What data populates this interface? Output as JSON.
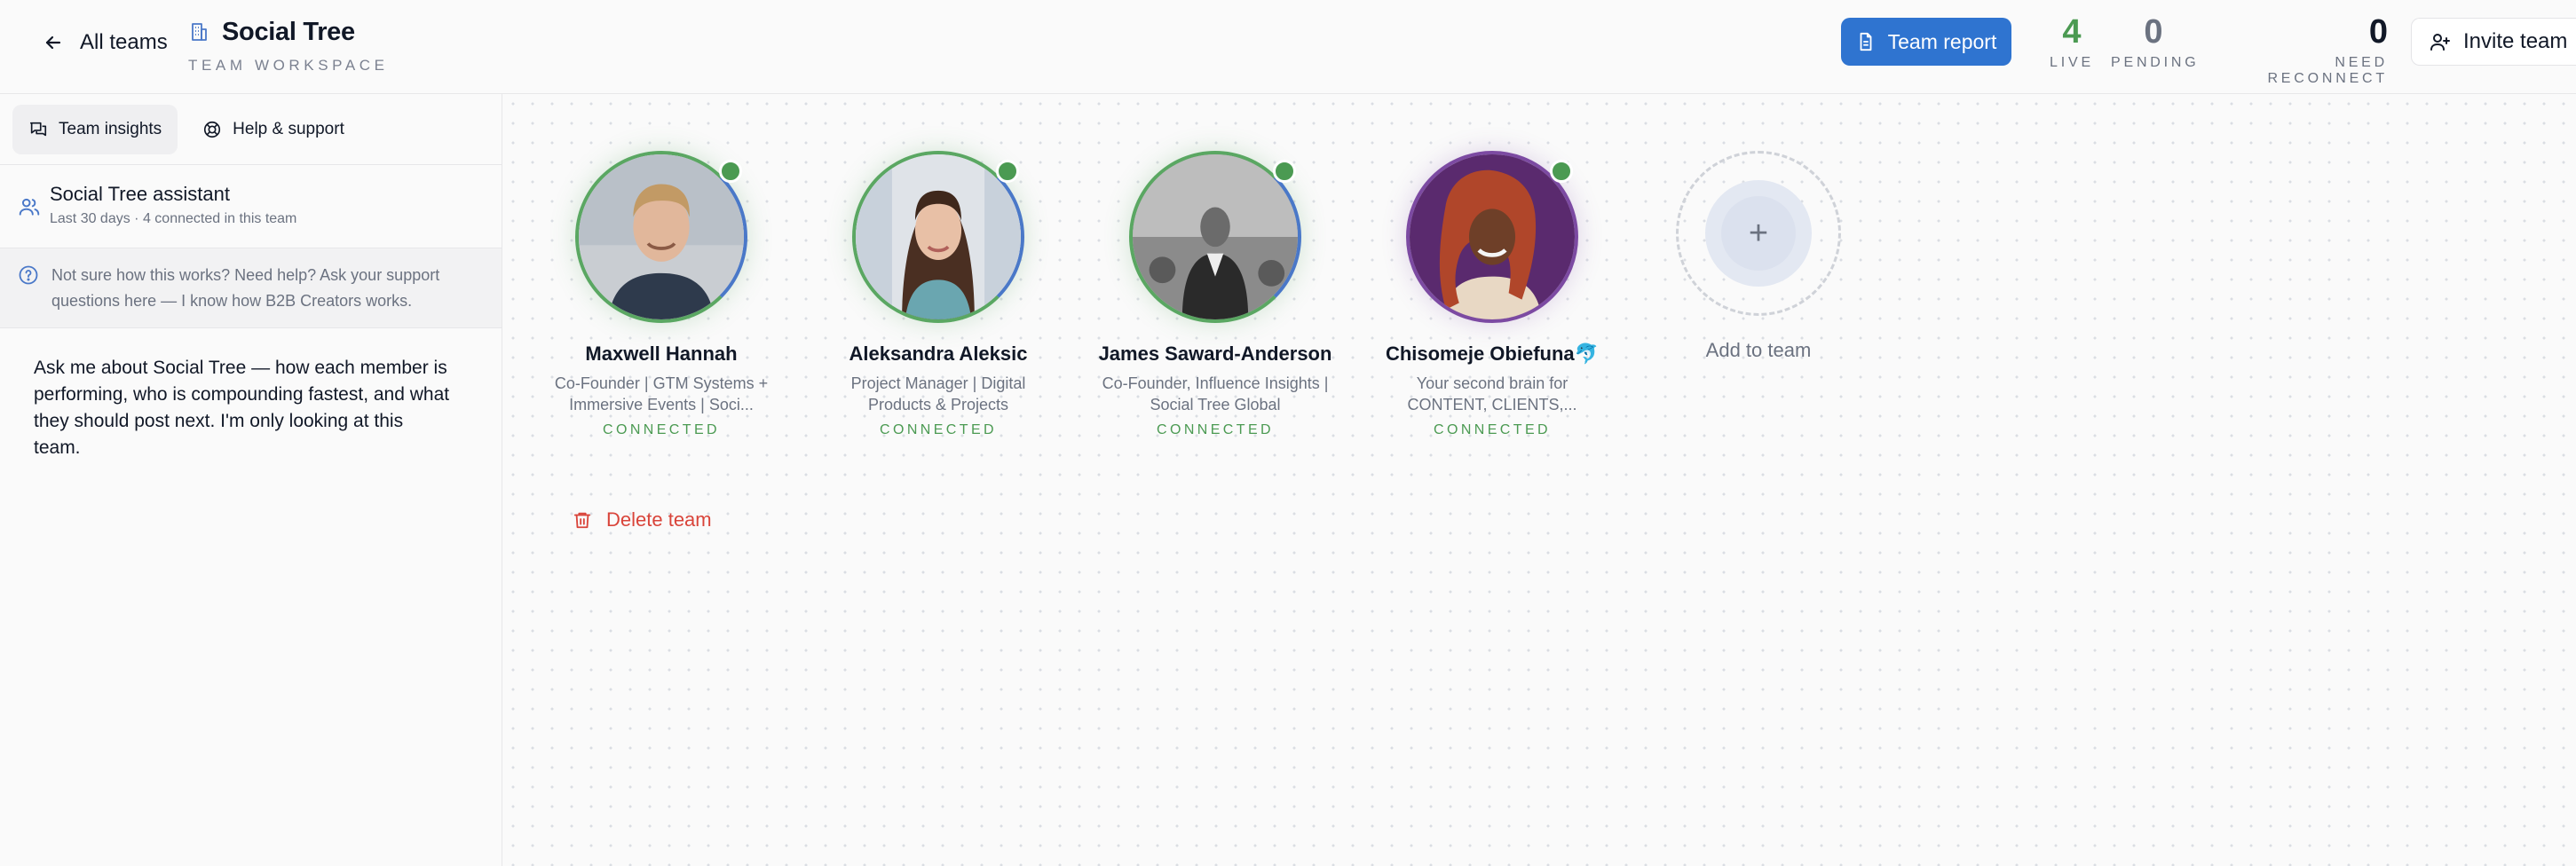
{
  "header": {
    "back_label": "All teams",
    "team_name": "Social Tree",
    "team_subtitle": "TEAM WORKSPACE",
    "report_label": "Team report",
    "invite_label": "Invite team",
    "stats": [
      {
        "value": "4",
        "label": "LIVE"
      },
      {
        "value": "0",
        "label": "PENDING"
      },
      {
        "value": "0",
        "label": "NEED RECONNECT"
      }
    ]
  },
  "sidebar": {
    "tabs": [
      {
        "label": "Team insights",
        "icon": "chat-bubbles-icon"
      },
      {
        "label": "Help & support",
        "icon": "lifebuoy-icon"
      }
    ],
    "assistant": {
      "title": "Social Tree assistant",
      "subtitle": "Last 30 days · 4 connected in this team"
    },
    "help_text": "Not sure how this works? Need help? Ask your support questions here — I know how B2B Creators works.",
    "message": "Ask me about Social Tree — how each member is performing, who is compounding fastest, and what they should post next. I'm only looking at this team."
  },
  "members": [
    {
      "name": "Maxwell Hannah",
      "headline": "Co-Founder | GTM Systems + Immersive Events | Soci...",
      "status": "CONNECTED"
    },
    {
      "name": "Aleksandra Aleksic",
      "headline": "Project Manager | Digital Products & Projects",
      "status": "CONNECTED"
    },
    {
      "name": "James Saward-Anderson",
      "headline": "Co-Founder, Influence Insights | Social Tree Global",
      "status": "CONNECTED"
    },
    {
      "name": "Chisomeje Obiefuna🐬",
      "headline": "Your second brain for CONTENT, CLIENTS,...",
      "status": "CONNECTED"
    }
  ],
  "add_member_label": "Add to team",
  "delete_label": "Delete team",
  "colors": {
    "accent": "#2f74d0",
    "live": "#4b9a52",
    "danger": "#d9443a"
  }
}
